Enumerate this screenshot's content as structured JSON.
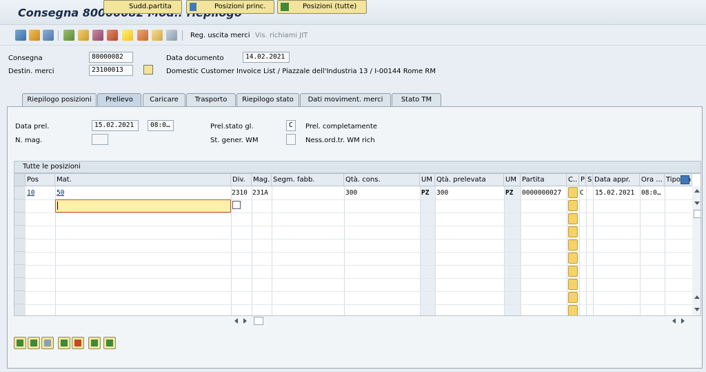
{
  "window": {
    "title": "Consegna 80000082 Mod.: riepilogo"
  },
  "toolbar": {
    "icons": [
      "edit-pencil-icon",
      "change-icon",
      "delete-icon",
      "structure-icon",
      "partner-icon",
      "print-icon",
      "messages-icon",
      "goods-issue-icon",
      "pick-icon",
      "batch-icon",
      "documents-icon"
    ],
    "reg_uscita_merci": "Reg. uscita merci",
    "vis_richiami_jit": "Vis. richiami JIT"
  },
  "header": {
    "consegna_label": "Consegna",
    "consegna_value": "80000082",
    "data_documento_label": "Data documento",
    "data_documento_value": "14.02.2021",
    "destin_merci_label": "Destin. merci",
    "destin_merci_value": "23100013",
    "destin_merci_desc": "Domestic Customer Invoice List / Piazzale dell'Industria 13 / I-00144 Rome RM"
  },
  "tabs": [
    {
      "label": "Riepilogo posizioni"
    },
    {
      "label": "Prelievo"
    },
    {
      "label": "Caricare"
    },
    {
      "label": "Trasporto"
    },
    {
      "label": "Riepilogo stato"
    },
    {
      "label": "Dati moviment. merci"
    },
    {
      "label": "Stato TM"
    }
  ],
  "picking": {
    "data_prel_label": "Data prel.",
    "data_prel_value": "15.02.2021",
    "ora_prel_value": "08:0…",
    "n_mag_label": "N. mag.",
    "n_mag_value": "",
    "prel_stato_label": "Prel.stato gl.",
    "prel_stato_value": "C",
    "prel_stato_desc": "Prel. completamente",
    "st_gener_label": "St. gener. WM",
    "st_gener_value": "",
    "st_gener_desc": "Ness.ord.tr. WM rich"
  },
  "grid": {
    "title": "Tutte le posizioni",
    "columns": [
      "Pos",
      "Mat.",
      "Div.",
      "Mag.",
      "Segm. fabb.",
      "Qtà. cons.",
      "UM",
      "Qtà. prelevata",
      "UM",
      "Partita",
      "C..",
      "P",
      "S",
      "Data appr.",
      "Ora ...",
      "Tipo va"
    ],
    "row": {
      "pos": "10",
      "mat": "50",
      "div": "2310",
      "mag": "231A",
      "segm": "",
      "qta_cons": "300",
      "um1": "PZ",
      "qta_prel": "300",
      "um2": "PZ",
      "partita": "0000000027",
      "p": "C",
      "data_appr": "15.02.2021",
      "ora": "08:0…",
      "tipo_va": ""
    }
  },
  "buttons": {
    "sudd_partita": "Sudd.partita",
    "posizioni_princ": "Posizioni princ.",
    "posizioni_tutte": "Posizioni (tutte)"
  },
  "colors": {
    "accent": "#f2e49a",
    "flag": "#f5d36a",
    "selection": "#fdf0a8"
  }
}
